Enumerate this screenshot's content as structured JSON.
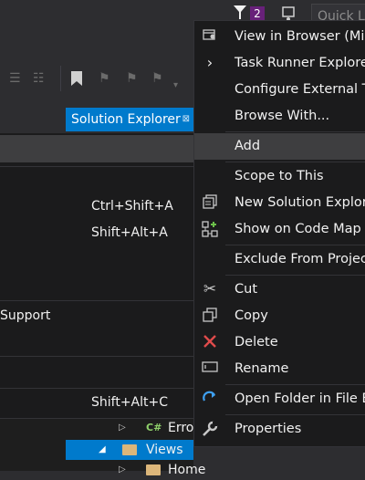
{
  "quick_launch": {
    "text": "Quick La"
  },
  "notification_badge": "2",
  "solution_explorer": {
    "tab_label": "Solution Explorer",
    "pin_glyph": "⊠"
  },
  "submenu": {
    "items": [
      {
        "label": "",
        "shortcut": ""
      },
      {
        "label": "",
        "shortcut": "Ctrl+Shift+A"
      },
      {
        "label": "",
        "shortcut": "Shift+Alt+A"
      },
      {
        "label": "Support",
        "shortcut": ""
      },
      {
        "label": "",
        "shortcut": "Shift+Alt+C"
      }
    ]
  },
  "context_menu": {
    "items": [
      {
        "label": "View in Browser (Micr",
        "icon": "browser-icon"
      },
      {
        "label": "Task Runner Explorer",
        "icon": "chevron-right-icon"
      },
      {
        "label": "Configure External To",
        "icon": ""
      },
      {
        "label": "Browse With...",
        "icon": ""
      },
      {
        "label": "Add",
        "icon": ""
      },
      {
        "label": "Scope to This",
        "icon": ""
      },
      {
        "label": "New Solution Explore",
        "icon": "new-window-icon"
      },
      {
        "label": "Show on Code Map",
        "icon": "code-map-icon"
      },
      {
        "label": "Exclude From Project",
        "icon": ""
      },
      {
        "label": "Cut",
        "icon": "scissors-icon"
      },
      {
        "label": "Copy",
        "icon": "copy-icon"
      },
      {
        "label": "Delete",
        "icon": "delete-icon"
      },
      {
        "label": "Rename",
        "icon": "rename-icon"
      },
      {
        "label": "Open Folder in File Ex",
        "icon": "refresh-icon"
      },
      {
        "label": "Properties",
        "icon": "wrench-icon"
      }
    ]
  },
  "tree": {
    "error_item": "Erro",
    "error_prefix": "C#",
    "views_label": "Views",
    "home_label": "Home"
  },
  "colors": {
    "accent": "#007acc",
    "menu_bg": "#1b1b1c",
    "highlight": "#3e3e40",
    "delete_red": "#e04b4b"
  }
}
